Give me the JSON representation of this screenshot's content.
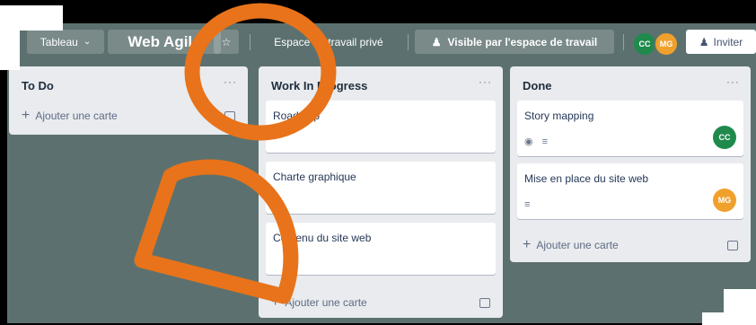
{
  "header": {
    "board_menu": "Tableau",
    "board_title": "Web Agile",
    "workspace_label": "Espace de travail privé",
    "visibility_label": "Visible par l'espace de travail",
    "invite_label": "Inviter",
    "members": [
      {
        "initials": "CC",
        "color": "#1f8a4c"
      },
      {
        "initials": "MG",
        "color": "#f0a02c"
      }
    ]
  },
  "lists": {
    "todo": {
      "title": "To Do",
      "menu": "···",
      "add_label": "Ajouter une carte"
    },
    "wip": {
      "title": "Work In Progress",
      "menu": "···",
      "cards": [
        {
          "text": "Roadmap"
        },
        {
          "text": "Charte graphique"
        },
        {
          "text": "Contenu du site web"
        }
      ],
      "add_label": "Ajouter une carte"
    },
    "done": {
      "title": "Done",
      "menu": "···",
      "cards": [
        {
          "text": "Story mapping",
          "member": "CC",
          "member_color": "#1f8a4c"
        },
        {
          "text": "Mise en place du site web",
          "member": "MG",
          "member_color": "#f0a02c"
        }
      ],
      "add_label": "Ajouter une carte"
    }
  },
  "annotation": {
    "color": "#e8731a"
  }
}
